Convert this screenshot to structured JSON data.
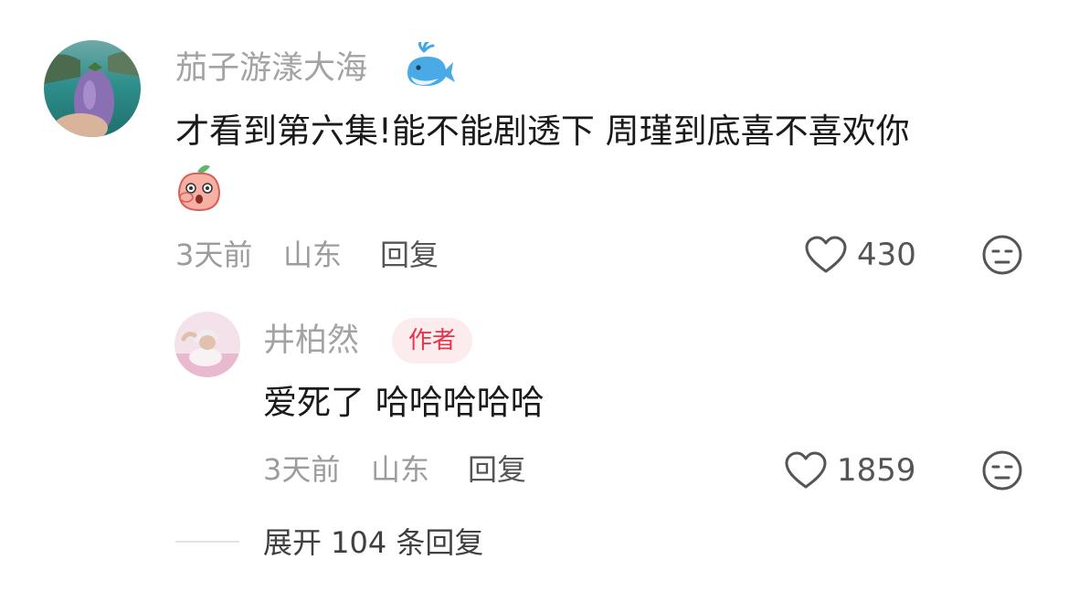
{
  "comment": {
    "username": "茄子游漾大海",
    "username_emoji": "whale-icon",
    "text": "才看到第六集!能不能剧透下 周瑾到底喜不喜欢你",
    "text_emoji": "peach-shocked-emoji",
    "time": "3天前",
    "location": "山东",
    "reply_label": "回复",
    "likes": "430"
  },
  "reply": {
    "username": "井柏然",
    "badge": "作者",
    "text": "爱死了 哈哈哈哈哈",
    "time": "3天前",
    "location": "山东",
    "reply_label": "回复",
    "likes": "1859"
  },
  "expand": {
    "label": "展开 104 条回复"
  },
  "colors": {
    "badge_text": "#e8334a",
    "badge_bg": "#fdecee",
    "username": "#a3a3a3",
    "text": "#1a1a1a",
    "meta": "#9c9c9c"
  }
}
